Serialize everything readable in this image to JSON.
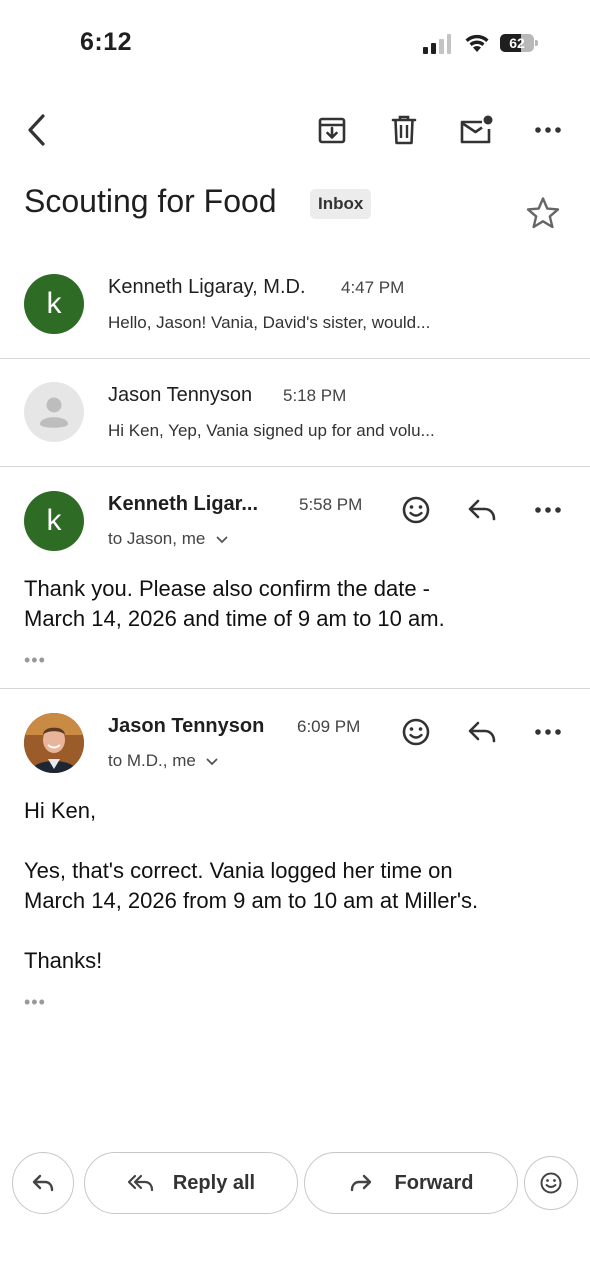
{
  "status_bar": {
    "time": "6:12",
    "battery": "62",
    "battery_level": 0.62
  },
  "toolbar": {
    "back_icon": "chevron-left-icon",
    "archive_icon": "archive-icon",
    "delete_icon": "trash-icon",
    "mark_unread_icon": "mail-unread-icon",
    "more_icon": "more-horizontal-icon"
  },
  "thread": {
    "subject": "Scouting for Food",
    "label": "Inbox",
    "star_icon": "star-outline-icon"
  },
  "messages": [
    {
      "sender": "Kenneth Ligaray, M.D.",
      "time": "4:47 PM",
      "snippet": "Hello, Jason! Vania, David's sister, would...",
      "avatar_letter": "k",
      "avatar_color": "#2e6b25"
    },
    {
      "sender": "Jason Tennyson",
      "time": "5:18 PM",
      "snippet": "Hi Ken, Yep, Vania signed up for and volu...",
      "avatar_icon": "person-placeholder-icon"
    },
    {
      "sender": "Kenneth Ligar...",
      "time": "5:58 PM",
      "recipients": "to Jason, me",
      "avatar_letter": "k",
      "avatar_color": "#2e6b25",
      "body": "Thank you. Please also confirm the date -\nMarch 14, 2026 and time of 9 am to 10 am.",
      "ellipsis": "•••"
    },
    {
      "sender": "Jason Tennyson",
      "time": "6:09 PM",
      "recipients": "to M.D., me",
      "avatar_icon": "profile-photo",
      "body": "Hi Ken,\n\nYes, that's correct. Vania logged her time on\nMarch 14, 2026 from 9 am to 10 am at Miller's.\n\nThanks!",
      "ellipsis": "•••"
    }
  ],
  "bottom_bar": {
    "reply_all": "Reply all",
    "forward": "Forward",
    "reply_icon": "reply-icon",
    "reply_all_icon": "reply-all-icon",
    "forward_icon": "forward-icon",
    "emoji_icon": "emoji-icon"
  },
  "colors": {
    "accent_green": "#2e6b25",
    "divider": "#d6d6d6"
  }
}
